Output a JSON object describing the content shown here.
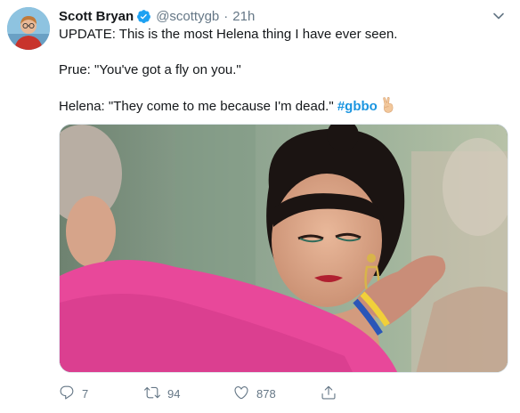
{
  "tweet": {
    "author_name": "Scott Bryan",
    "handle": "@scottygb",
    "separator": "·",
    "time": "21h",
    "lines": [
      "UPDATE: This is the most Helena thing I have ever seen.",
      "Prue: \"You've got a fly on you.\"",
      "Helena: \"They come to me because I'm dead.\""
    ],
    "hashtag": "#gbbo"
  },
  "actions": {
    "reply_count": "7",
    "retweet_count": "94",
    "like_count": "878"
  },
  "icons": {
    "verified": "verified-badge-icon",
    "caret": "chevron-down-icon",
    "reply": "reply-icon",
    "retweet": "retweet-icon",
    "like": "heart-icon",
    "share": "share-icon",
    "emoji": "peace-hand-emoji"
  },
  "colors": {
    "text": "#14171a",
    "secondary": "#657786",
    "link": "#1b95e0",
    "verified": "#1da1f2"
  }
}
